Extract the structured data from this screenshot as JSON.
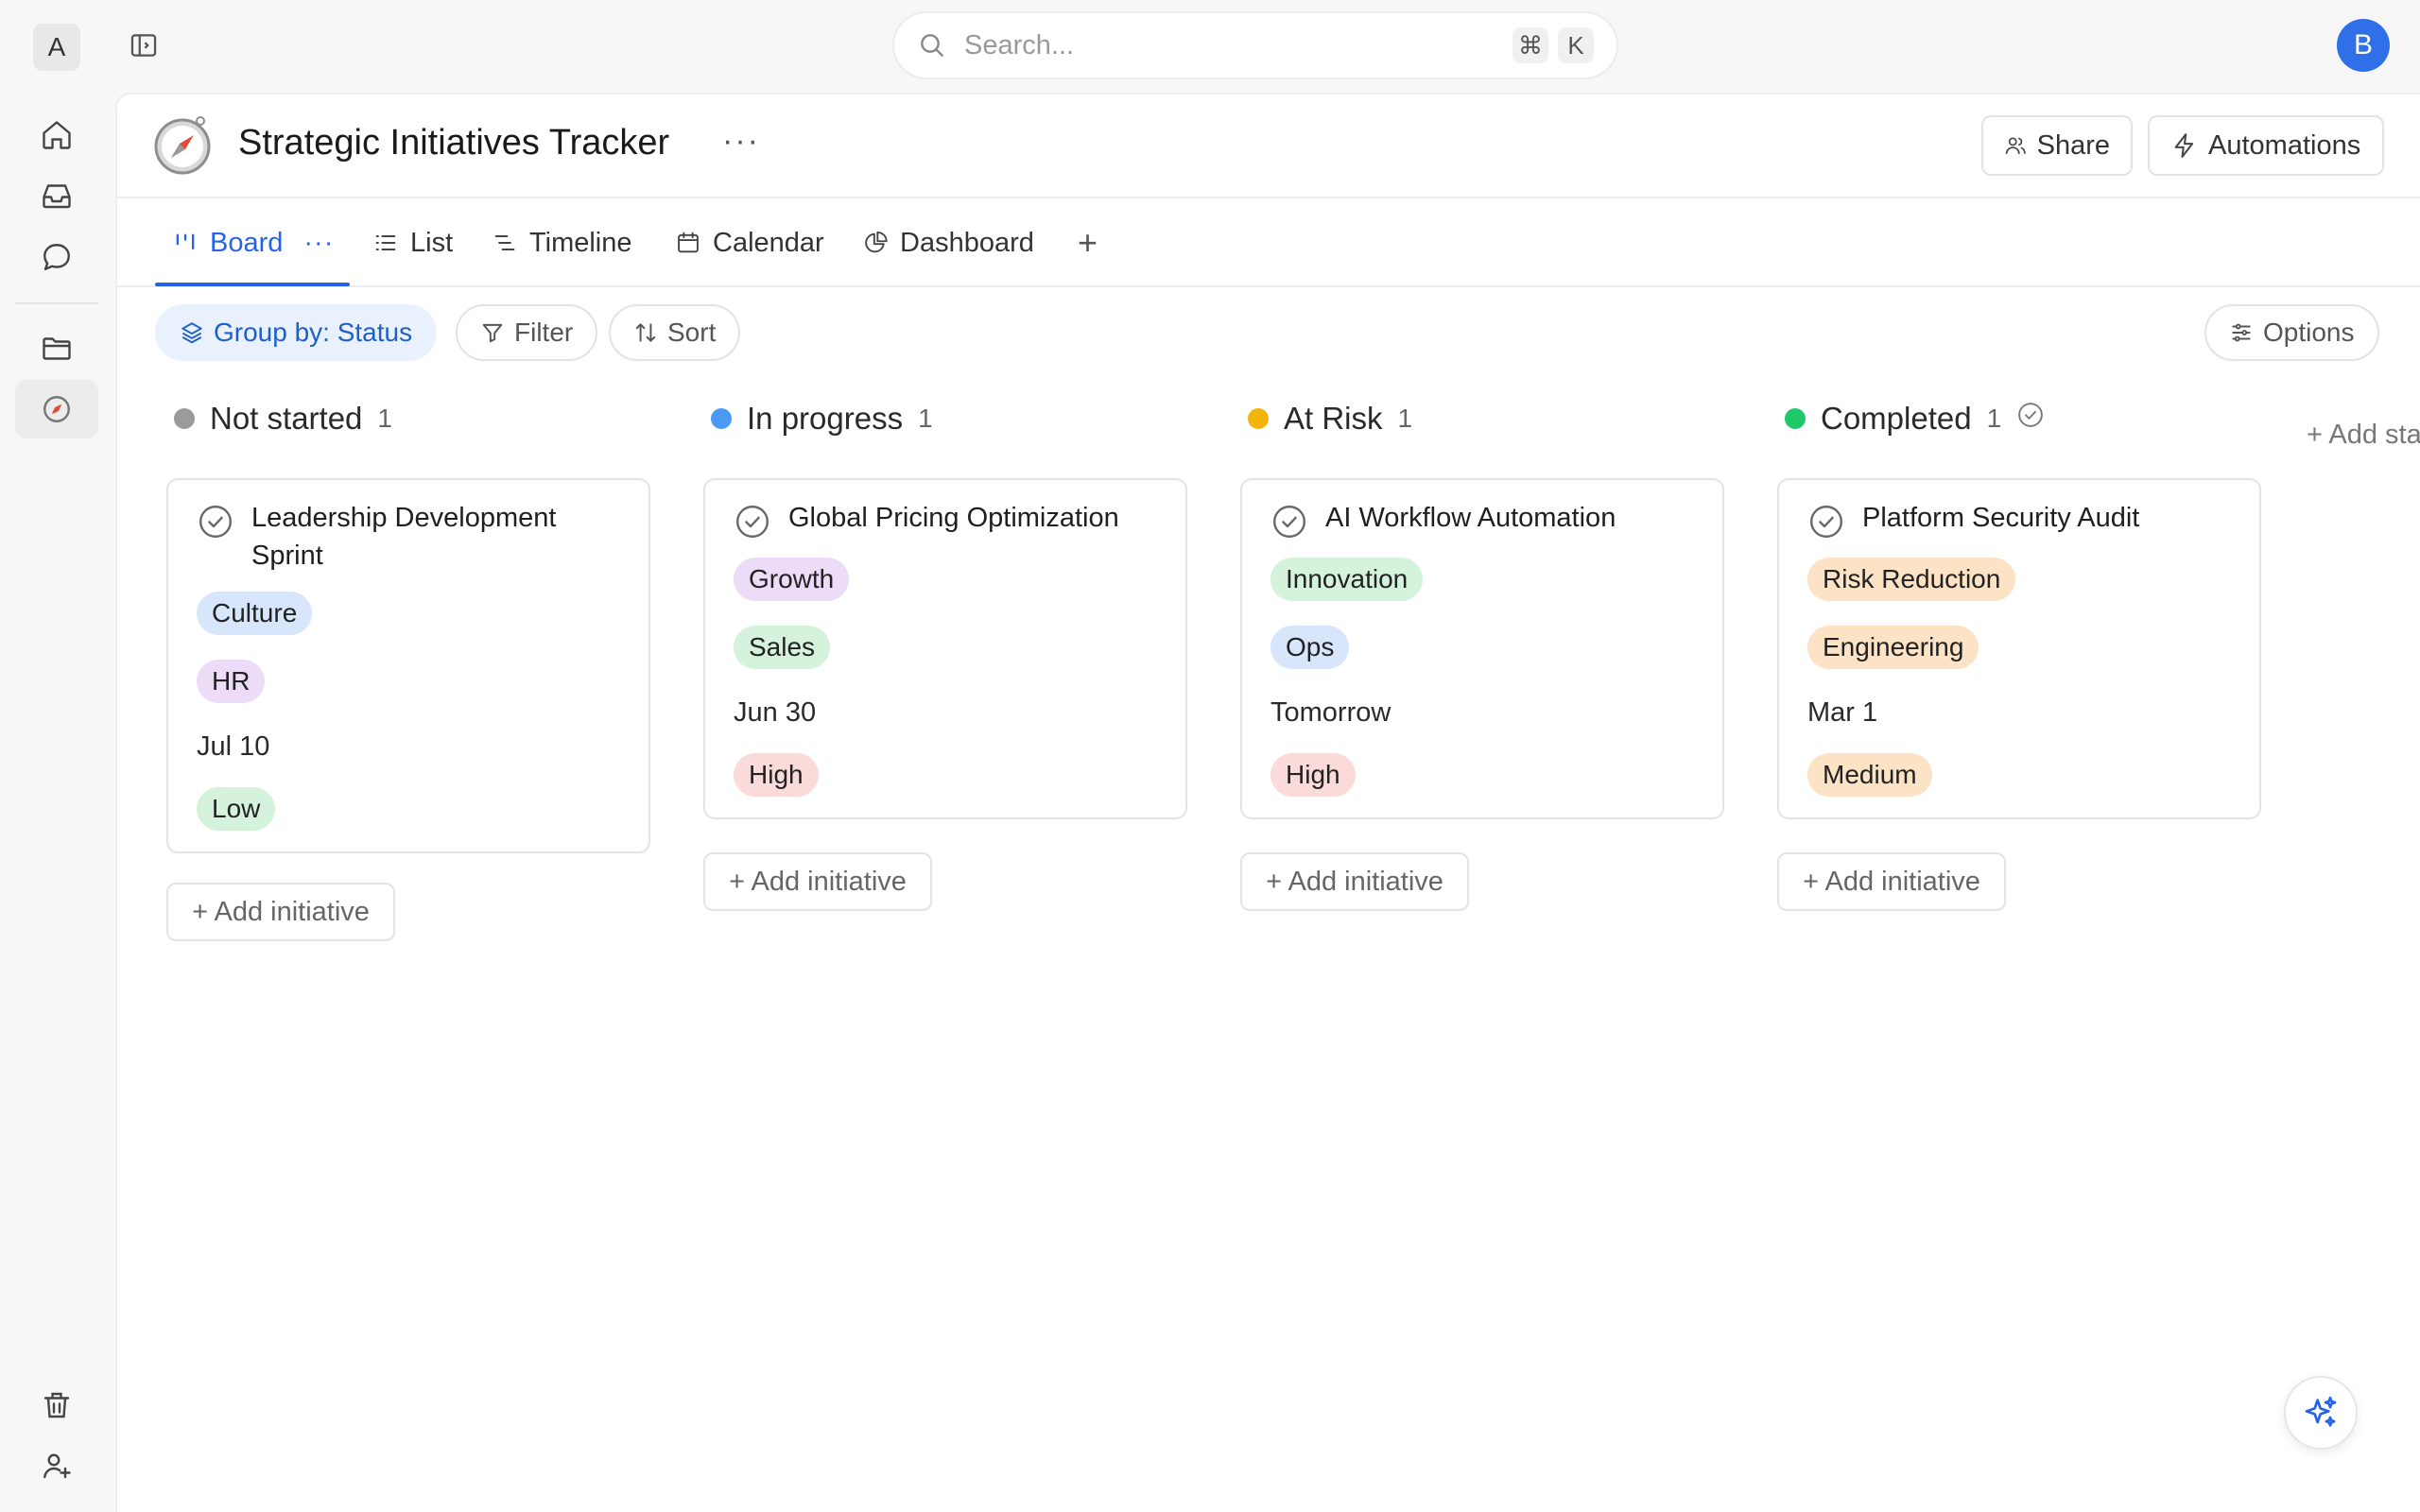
{
  "workspace": {
    "initial": "A"
  },
  "user": {
    "initial": "B"
  },
  "search": {
    "placeholder": "Search...",
    "shortcut_mod": "⌘",
    "shortcut_key": "K"
  },
  "page": {
    "title": "Strategic Initiatives Tracker",
    "more": "···"
  },
  "header_actions": {
    "share": "Share",
    "automations": "Automations"
  },
  "tabs": [
    {
      "label": "Board",
      "active": true
    },
    {
      "label": "List"
    },
    {
      "label": "Timeline"
    },
    {
      "label": "Calendar"
    },
    {
      "label": "Dashboard"
    }
  ],
  "tab_more": "···",
  "tab_add": "+",
  "toolbar": {
    "group_by": "Group by: Status",
    "filter": "Filter",
    "sort": "Sort",
    "options": "Options"
  },
  "add_status": "+ Add status",
  "columns": [
    {
      "name": "Not started",
      "count": "1",
      "color": "#9b9b9b",
      "card": {
        "title": "Leadership Development Sprint",
        "tags1": [
          {
            "label": "Culture",
            "color": "#d8e6fb"
          },
          {
            "label": "HR",
            "color": "#ecdcf7"
          }
        ],
        "date": "Jul 10",
        "priority": {
          "label": "Low",
          "color": "#d4f2dc"
        }
      }
    },
    {
      "name": "In progress",
      "count": "1",
      "color": "#4a9af3",
      "card": {
        "title": "Global Pricing Optimization",
        "tags1": [
          {
            "label": "Growth",
            "color": "#ecdcf7"
          },
          {
            "label": "Sales",
            "color": "#d4f2dc"
          }
        ],
        "date": "Jun 30",
        "priority": {
          "label": "High",
          "color": "#fbdada"
        }
      }
    },
    {
      "name": "At Risk",
      "count": "1",
      "color": "#f2b50c",
      "card": {
        "title": "AI Workflow Automation",
        "tags1": [
          {
            "label": "Innovation",
            "color": "#d4f2dc"
          },
          {
            "label": "Ops",
            "color": "#d8e6fb"
          }
        ],
        "date": "Tomorrow",
        "priority": {
          "label": "High",
          "color": "#fbdada"
        }
      }
    },
    {
      "name": "Completed",
      "count": "1",
      "color": "#1fc96a",
      "card": {
        "title": "Platform Security Audit",
        "tags1": [
          {
            "label": "Risk Reduction",
            "color": "#fde3c6"
          },
          {
            "label": "Engineering",
            "color": "#fde3c6"
          }
        ],
        "date": "Mar 1",
        "priority": {
          "label": "Medium",
          "color": "#fde3c6"
        }
      }
    }
  ],
  "add_initiative": "+ Add initiative"
}
